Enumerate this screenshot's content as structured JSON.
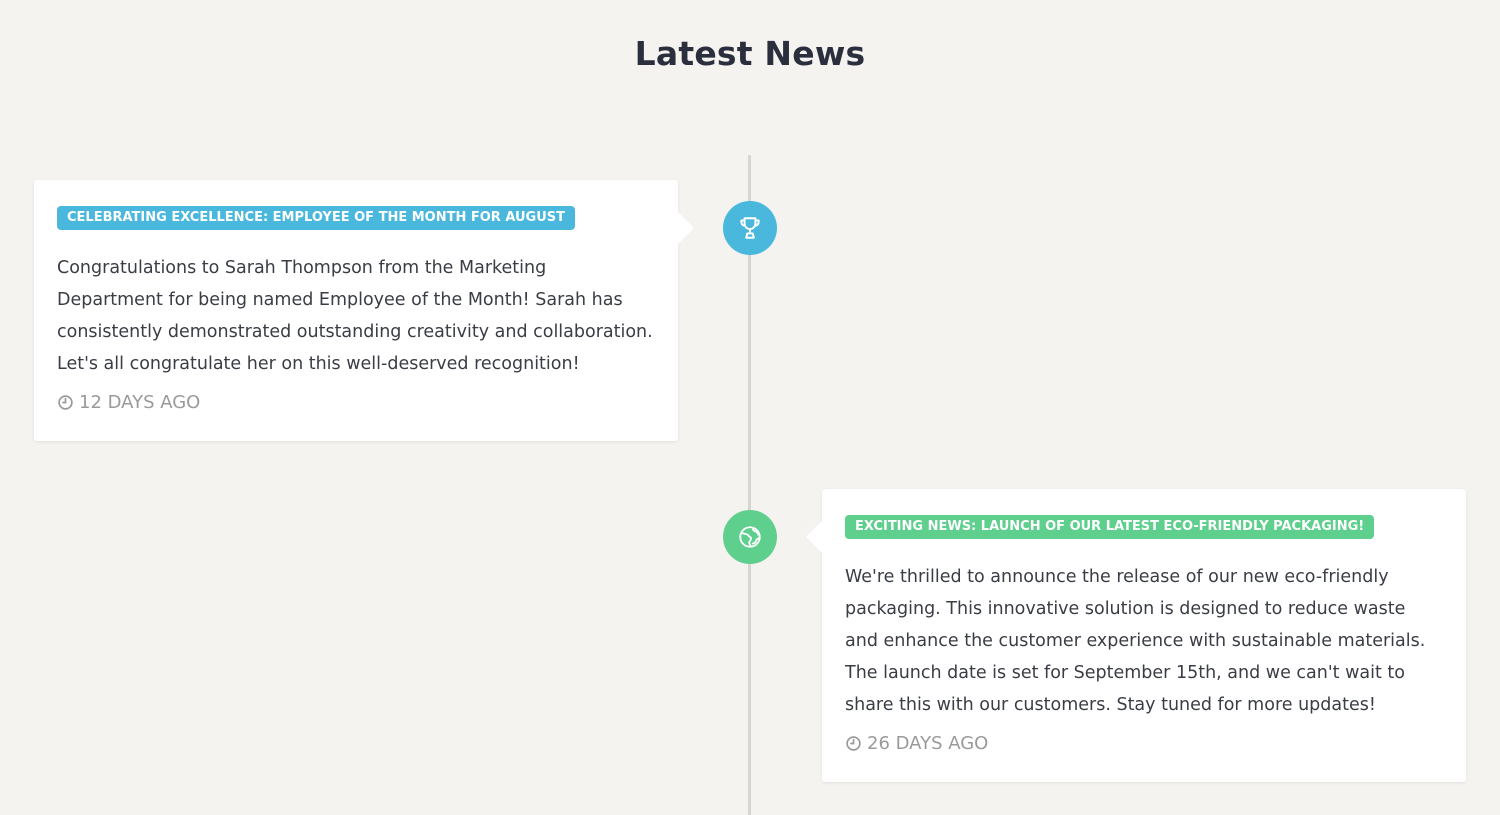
{
  "page": {
    "title": "Latest News"
  },
  "colors": {
    "background": "#f4f3f0",
    "timeline_line": "#d7d6d3",
    "accent_blue": "#4ab8dc",
    "accent_green": "#5fcf8e",
    "meta_gray": "#9a9a9a"
  },
  "news": [
    {
      "tag": "CELEBRATING EXCELLENCE: EMPLOYEE OF THE MONTH FOR AUGUST",
      "body": "Congratulations to Sarah Thompson from the Marketing Department for being named Employee of the Month! Sarah has consistently demonstrated outstanding creativity and collaboration. Let's all congratulate her on this well-deserved recognition!",
      "time": "12 DAYS AGO",
      "icon": "trophy-icon",
      "color": "#4ab8dc",
      "side": "left"
    },
    {
      "tag": "EXCITING NEWS: LAUNCH OF OUR LATEST ECO-FRIENDLY PACKAGING!",
      "body": "We're thrilled to announce the release of our new eco-friendly packaging. This innovative solution is designed to reduce waste and enhance the customer experience with sustainable materials. The launch date is set for September 15th, and we can't wait to share this with our customers. Stay tuned for more updates!",
      "time": "26 DAYS AGO",
      "icon": "globe-icon",
      "color": "#5fcf8e",
      "side": "right"
    }
  ]
}
